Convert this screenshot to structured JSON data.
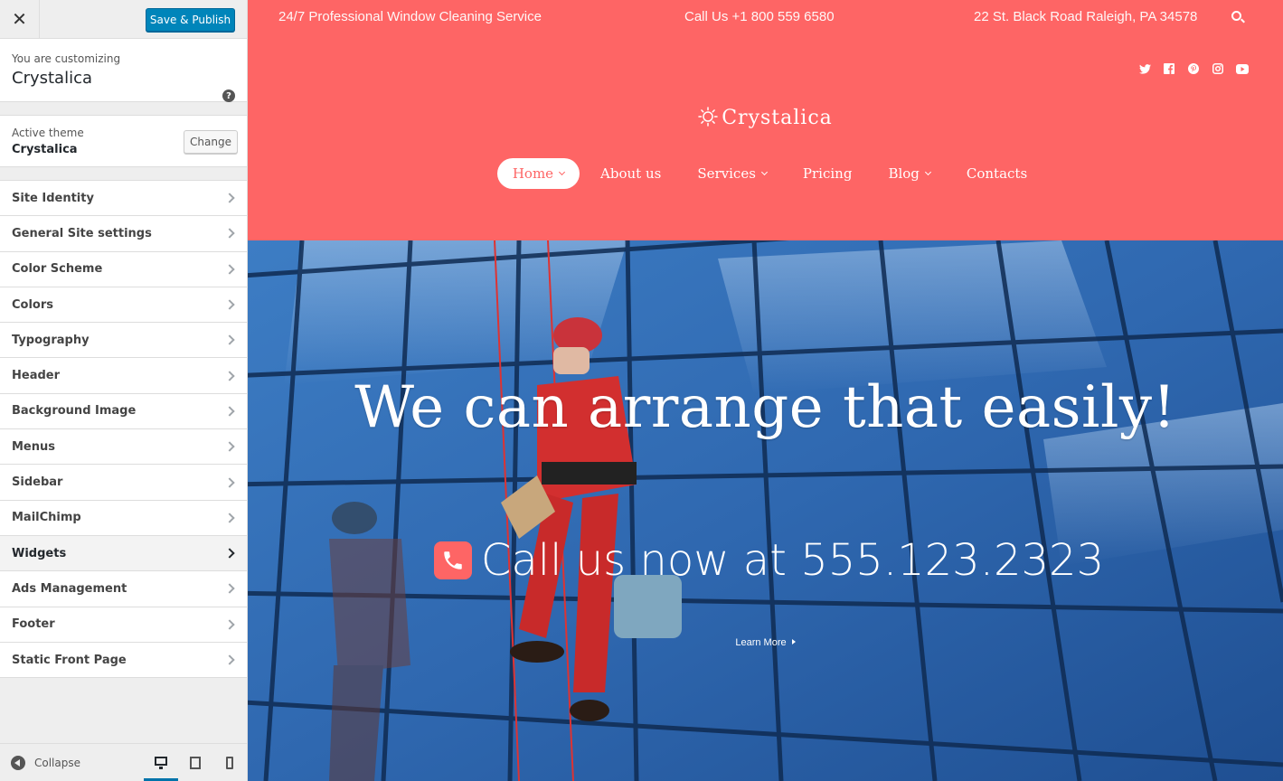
{
  "customizer": {
    "save_label": "Save & Publish",
    "customizing_label": "You are customizing",
    "site_title": "Crystalica",
    "active_theme_label": "Active theme",
    "active_theme_name": "Crystalica",
    "change_label": "Change",
    "sections": [
      "Site Identity",
      "General Site settings",
      "Color Scheme",
      "Colors",
      "Typography",
      "Header",
      "Background Image",
      "Menus",
      "Sidebar",
      "MailChimp",
      "Widgets",
      "Ads Management",
      "Footer",
      "Static Front Page"
    ],
    "active_section": "Widgets",
    "collapse_label": "Collapse",
    "preview_device": "desktop"
  },
  "site": {
    "tagline": "24/7 Professional Window Cleaning Service",
    "phone": "Call Us +1 800 559 6580",
    "address": "22 St. Black Road Raleigh, PA 34578",
    "logo": "Crystalica",
    "social_icons": [
      "twitter-icon",
      "facebook-icon",
      "pinterest-icon",
      "instagram-icon",
      "youtube-icon"
    ],
    "nav": [
      {
        "label": "Home",
        "dropdown": true,
        "active": true
      },
      {
        "label": "About us",
        "dropdown": false
      },
      {
        "label": "Services",
        "dropdown": true
      },
      {
        "label": "Pricing",
        "dropdown": false
      },
      {
        "label": "Blog",
        "dropdown": true
      },
      {
        "label": "Contacts",
        "dropdown": false
      }
    ],
    "hero": {
      "title": "We can arrange that easily!",
      "call": "Call us now at 555.123.2323",
      "cta": "Learn More"
    },
    "colors": {
      "accent": "#fe6565",
      "wp_blue": "#0085ba"
    }
  }
}
